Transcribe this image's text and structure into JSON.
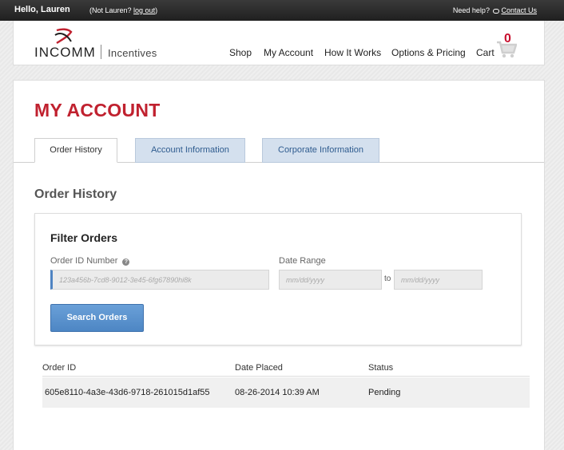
{
  "topbar": {
    "greeting": "Hello, Lauren",
    "not_user_prefix": "(Not Lauren? ",
    "logout_link": "log out",
    "not_user_suffix": ")",
    "help_text": "Need help?",
    "contact_link": "Contact Us"
  },
  "header": {
    "brand": "INCOMM",
    "brand_sub": "Incentives",
    "nav": [
      "Shop",
      "My Account",
      "How It Works",
      "Options & Pricing",
      "Cart"
    ],
    "cart_count": "0"
  },
  "page": {
    "title": "MY ACCOUNT",
    "tabs": [
      {
        "label": "Order History",
        "active": true
      },
      {
        "label": "Account Information",
        "active": false
      },
      {
        "label": "Corporate Information",
        "active": false
      }
    ],
    "section_title": "Order History"
  },
  "filter": {
    "title": "Filter Orders",
    "order_id_label": "Order ID Number",
    "order_id_placeholder": "123a456b-7cd8-9012-3e45-6fg67890hi8k",
    "date_range_label": "Date Range",
    "date_from_placeholder": "mm/dd/yyyy",
    "date_to_text": "to",
    "date_to_placeholder": "mm/dd/yyyy",
    "search_button": "Search Orders"
  },
  "orders": {
    "columns": [
      "Order ID",
      "Date Placed",
      "Status"
    ],
    "rows": [
      {
        "order_id": "605e8110-4a3e-43d6-9718-261015d1af55",
        "date": "08-26-2014 10:39 AM",
        "status": "Pending"
      }
    ]
  },
  "colors": {
    "accent_red": "#c0212f",
    "button_blue": "#4d86c4",
    "inactive_tab": "#d4e0ee"
  }
}
